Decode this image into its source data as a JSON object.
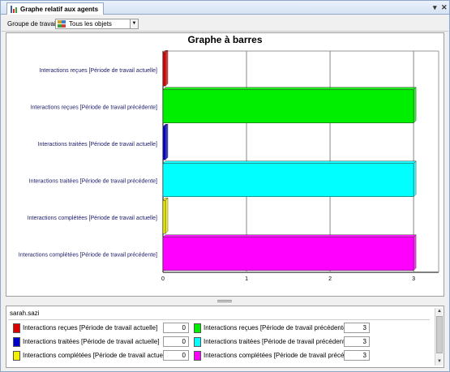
{
  "window": {
    "title": "Graphe relatif aux agents",
    "pin": "▾",
    "close": "✕"
  },
  "toolbar": {
    "group_label": "Groupe de travail:",
    "group_value": "Tous les objets"
  },
  "chart_data": {
    "type": "bar",
    "orientation": "horizontal",
    "title": "Graphe à barres",
    "categories": [
      "Interactions reçues [Période de travail actuelle]",
      "Interactions reçues [Période de travail précédente]",
      "Interactions traitées [Période de travail actuelle]",
      "Interactions traitées [Période de travail précédente]",
      "Interactions complétées [Période de travail actuelle]",
      "Interactions complétées [Période de travail précédente]"
    ],
    "values": [
      0,
      3,
      0,
      3,
      0,
      3
    ],
    "colors": [
      "#e00000",
      "#00ee00",
      "#0000cc",
      "#00ffff",
      "#f0f000",
      "#ff00ff"
    ],
    "xlim": [
      0,
      3.3
    ],
    "xticks": [
      "0",
      "1",
      "2",
      "3"
    ],
    "grid": true,
    "xlabel": "",
    "ylabel": ""
  },
  "legend": {
    "agent": "sarah.sazi",
    "items": [
      {
        "label": "Interactions reçues [Période de travail actuelle]",
        "value": "0",
        "color": "#e00000"
      },
      {
        "label": "Interactions reçues [Période de travail précédente]",
        "value": "3",
        "color": "#00ee00"
      },
      {
        "label": "Interactions traitées [Période de travail actuelle]",
        "value": "0",
        "color": "#0000cc"
      },
      {
        "label": "Interactions traitées [Période de travail précédente]",
        "value": "3",
        "color": "#00ffff"
      },
      {
        "label": "Interactions complétées [Période de travail actuelle]",
        "value": "0",
        "color": "#f0f000"
      },
      {
        "label": "Interactions complétées [Période de travail précédente]",
        "value": "3",
        "color": "#ff00ff"
      }
    ]
  }
}
